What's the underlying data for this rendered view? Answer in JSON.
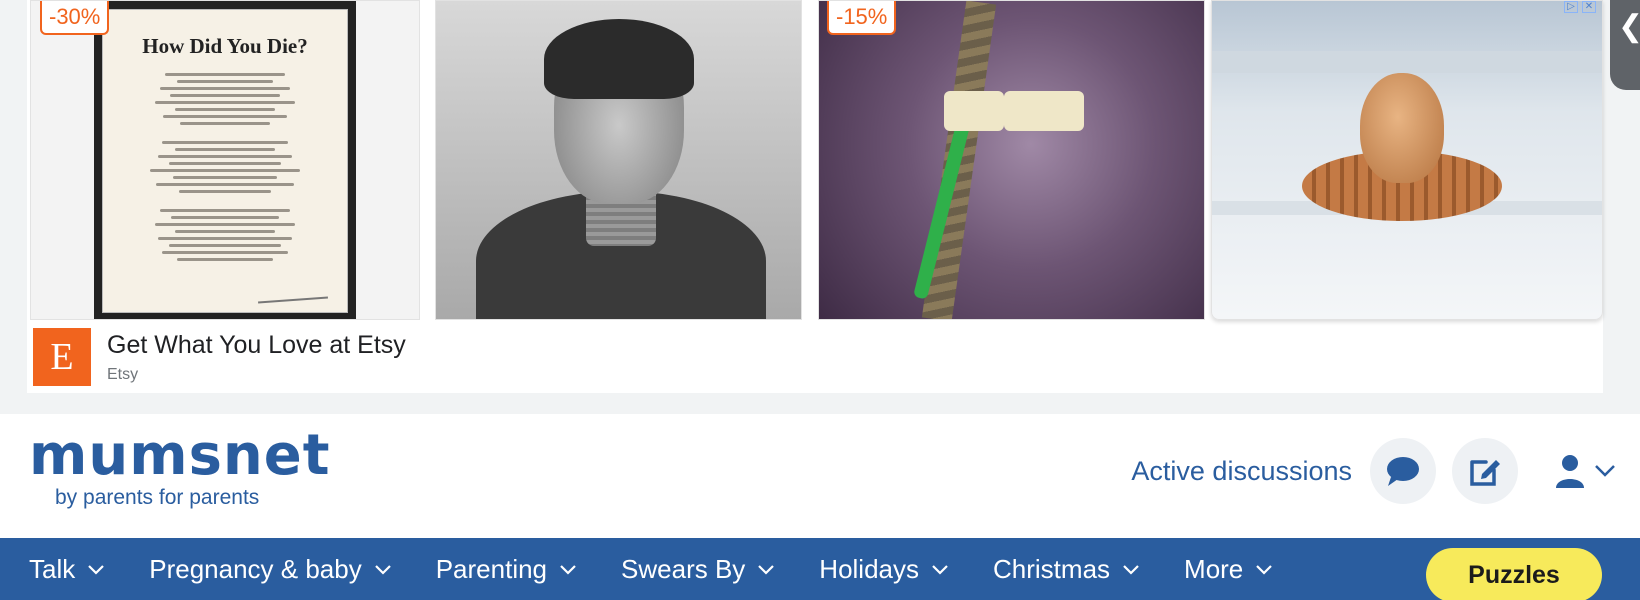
{
  "ad": {
    "tiles": [
      {
        "discount": "-30%",
        "poster_title": "How Did You Die?"
      },
      {
        "discount": ""
      },
      {
        "discount": "-15%"
      },
      {
        "discount": ""
      }
    ],
    "headline": "Get What You Love at Etsy",
    "advertiser": "Etsy",
    "logo_letter": "E",
    "side_tab_glyph": "❮"
  },
  "header": {
    "logo_word": "mumsnet",
    "logo_tagline": "by parents for parents",
    "active_discussions": "Active discussions",
    "icons": [
      "speech-bubble-icon",
      "edit-icon",
      "user-icon",
      "chevron-down-icon"
    ]
  },
  "nav": {
    "items": [
      {
        "label": "Talk"
      },
      {
        "label": "Pregnancy & baby"
      },
      {
        "label": "Parenting"
      },
      {
        "label": "Swears By"
      },
      {
        "label": "Holidays"
      },
      {
        "label": "Christmas"
      },
      {
        "label": "More"
      }
    ],
    "puzzles_label": "Puzzles"
  },
  "colors": {
    "brand_blue": "#2a5d9f",
    "etsy_orange": "#f1641e",
    "puzzles_yellow": "#f7ea5b"
  }
}
